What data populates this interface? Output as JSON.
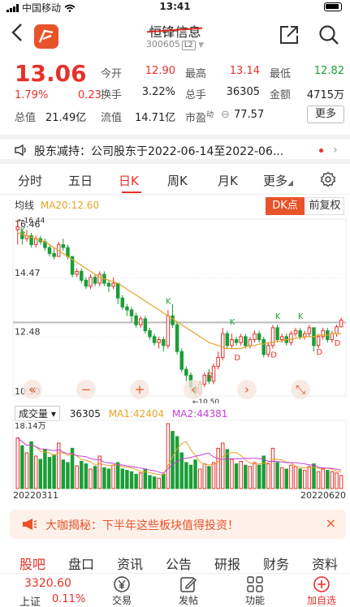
{
  "status": {
    "carrier": "中国移动",
    "time": "13:41"
  },
  "header": {
    "title": "恒锋信息",
    "code": "300605",
    "level": "L2"
  },
  "quote": {
    "price": "13.06",
    "change_pct": "1.79%",
    "change": "0.23",
    "open_label": "今开",
    "open": "12.90",
    "high_label": "最高",
    "high": "13.14",
    "low_label": "最低",
    "low": "12.82",
    "turnover_label": "换手",
    "turnover": "3.22%",
    "volume_label": "总手",
    "volume": "36305",
    "amount_label": "金额",
    "amount": "4715万",
    "total_cap_label": "总值",
    "total_cap": "21.49亿",
    "float_cap_label": "流值",
    "float_cap": "14.71亿",
    "pe_label": "市盈",
    "pe_sup": "动",
    "pe": "77.57",
    "more_label": "更多"
  },
  "notice": {
    "text": "股东减持：公司股东于2022-06-14至2022-06..."
  },
  "tabs": [
    "分时",
    "五日",
    "日K",
    "周K",
    "月K",
    "更多"
  ],
  "active_tab": "日K",
  "kline": {
    "ma_label": "均线",
    "ma20": "MA20:12.60",
    "dk_label": "DK点",
    "fq_label": "前复权",
    "max_label": "16.44",
    "min_label": "10.50"
  },
  "volume_row": {
    "label": "成交量",
    "value": "36305",
    "ma1": "MA1:42404",
    "ma2": "MA2:44381",
    "max_label": "18.14万"
  },
  "dates": {
    "start": "20220311",
    "end": "20220620"
  },
  "banner": {
    "text": "大咖揭秘：下半年这些板块值得投资！"
  },
  "bottom_tabs": [
    "股吧",
    "盘口",
    "资讯",
    "公告",
    "研报",
    "财务",
    "资料"
  ],
  "nav": {
    "index_value": "3320.60",
    "index_name": "上证",
    "index_pct": "0.11%",
    "items": [
      "交易",
      "发帖",
      "功能",
      "加自选"
    ]
  },
  "chart_data": {
    "type": "candlestick",
    "y_ticks": [
      16.46,
      14.47,
      12.48,
      10.5
    ],
    "ylim": [
      10.5,
      16.46
    ],
    "candles": [
      [
        16.1,
        16.2,
        16.44,
        15.6
      ],
      [
        16.0,
        15.8,
        16.1,
        15.6
      ],
      [
        15.8,
        15.9,
        16.1,
        15.7
      ],
      [
        15.9,
        15.6,
        16.0,
        15.5
      ],
      [
        15.6,
        15.8,
        15.9,
        15.5
      ],
      [
        15.8,
        15.7,
        15.9,
        15.6
      ],
      [
        15.7,
        15.5,
        15.8,
        15.4
      ],
      [
        15.5,
        15.3,
        15.6,
        15.2
      ],
      [
        15.3,
        15.2,
        15.5,
        15.1
      ],
      [
        15.2,
        15.6,
        15.7,
        15.2
      ],
      [
        15.6,
        15.5,
        15.8,
        15.4
      ],
      [
        15.5,
        15.2,
        15.6,
        15.1
      ],
      [
        15.2,
        14.6,
        15.2,
        14.5
      ],
      [
        14.6,
        14.7,
        14.8,
        14.5
      ],
      [
        14.7,
        14.4,
        14.8,
        14.3
      ],
      [
        14.4,
        14.2,
        14.5,
        14.1
      ],
      [
        14.2,
        14.5,
        14.6,
        14.1
      ],
      [
        14.5,
        14.3,
        14.6,
        14.2
      ],
      [
        14.3,
        14.6,
        14.7,
        14.2
      ],
      [
        14.6,
        14.3,
        14.7,
        14.2
      ],
      [
        14.3,
        14.2,
        14.4,
        14.0
      ],
      [
        14.2,
        14.3,
        14.5,
        14.1
      ],
      [
        14.3,
        13.8,
        14.3,
        13.6
      ],
      [
        13.8,
        13.5,
        13.9,
        13.4
      ],
      [
        13.5,
        13.4,
        13.6,
        13.2
      ],
      [
        13.4,
        13.2,
        13.5,
        13.0
      ],
      [
        13.2,
        12.9,
        13.3,
        12.8
      ],
      [
        12.9,
        13.1,
        13.2,
        12.8
      ],
      [
        13.1,
        12.7,
        13.2,
        12.6
      ],
      [
        12.7,
        12.5,
        12.8,
        12.4
      ],
      [
        12.5,
        12.3,
        12.6,
        12.2
      ],
      [
        12.3,
        12.4,
        12.5,
        12.1
      ],
      [
        12.4,
        12.2,
        12.5,
        12.0
      ],
      [
        12.2,
        13.2,
        13.4,
        12.1
      ],
      [
        13.2,
        12.9,
        13.6,
        12.8
      ],
      [
        12.9,
        12.0,
        13.0,
        11.9
      ],
      [
        12.0,
        11.4,
        12.1,
        11.3
      ],
      [
        11.4,
        11.2,
        11.5,
        11.0
      ],
      [
        11.2,
        10.8,
        11.3,
        10.6
      ],
      [
        10.8,
        10.6,
        10.9,
        10.5
      ],
      [
        10.6,
        10.9,
        11.0,
        10.5
      ],
      [
        10.9,
        11.2,
        11.3,
        10.8
      ],
      [
        11.2,
        11.0,
        11.4,
        10.9
      ],
      [
        11.0,
        11.5,
        11.6,
        10.9
      ],
      [
        11.5,
        11.8,
        12.0,
        11.4
      ],
      [
        11.8,
        12.6,
        12.8,
        11.7
      ],
      [
        12.6,
        12.2,
        12.7,
        12.1
      ],
      [
        12.2,
        12.4,
        12.6,
        12.1
      ],
      [
        12.4,
        12.3,
        12.5,
        12.2
      ],
      [
        12.3,
        12.5,
        12.6,
        12.2
      ],
      [
        12.5,
        12.2,
        12.6,
        12.1
      ],
      [
        12.2,
        12.4,
        12.5,
        12.1
      ],
      [
        12.4,
        12.6,
        12.7,
        12.3
      ],
      [
        12.6,
        12.4,
        12.7,
        12.3
      ],
      [
        12.4,
        11.9,
        12.5,
        11.8
      ],
      [
        11.9,
        12.2,
        12.3,
        11.8
      ],
      [
        12.2,
        12.8,
        12.9,
        12.1
      ],
      [
        12.8,
        12.4,
        12.9,
        12.3
      ],
      [
        12.4,
        12.5,
        12.6,
        12.3
      ],
      [
        12.5,
        12.3,
        12.6,
        12.2
      ],
      [
        12.3,
        12.6,
        12.7,
        12.2
      ],
      [
        12.6,
        12.7,
        12.8,
        12.5
      ],
      [
        12.7,
        12.5,
        12.8,
        12.4
      ],
      [
        12.5,
        12.6,
        12.7,
        12.4
      ],
      [
        12.6,
        12.8,
        12.9,
        12.5
      ],
      [
        12.8,
        12.2,
        12.8,
        12.0
      ],
      [
        12.2,
        12.5,
        12.6,
        12.1
      ],
      [
        12.5,
        12.7,
        12.8,
        12.4
      ],
      [
        12.7,
        12.4,
        12.8,
        12.3
      ],
      [
        12.4,
        12.6,
        12.7,
        12.3
      ],
      [
        12.6,
        12.83,
        12.9,
        12.5
      ],
      [
        12.83,
        13.06,
        13.14,
        12.82
      ]
    ],
    "ma20": [
      16.0,
      15.95,
      15.9,
      15.85,
      15.8,
      15.75,
      15.7,
      15.6,
      15.5,
      15.4,
      15.3,
      15.2,
      15.1,
      15.0,
      14.9,
      14.8,
      14.7,
      14.6,
      14.5,
      14.45,
      14.4,
      14.35,
      14.3,
      14.2,
      14.1,
      14.0,
      13.9,
      13.8,
      13.7,
      13.6,
      13.5,
      13.4,
      13.3,
      13.2,
      13.1,
      13.0,
      12.9,
      12.8,
      12.7,
      12.6,
      12.5,
      12.4,
      12.3,
      12.25,
      12.2,
      12.15,
      12.1,
      12.1,
      12.1,
      12.1,
      12.15,
      12.2,
      12.2,
      12.25,
      12.25,
      12.3,
      12.3,
      12.35,
      12.35,
      12.4,
      12.4,
      12.45,
      12.45,
      12.5,
      12.5,
      12.5,
      12.55,
      12.55,
      12.55,
      12.6,
      12.6,
      12.6
    ]
  }
}
